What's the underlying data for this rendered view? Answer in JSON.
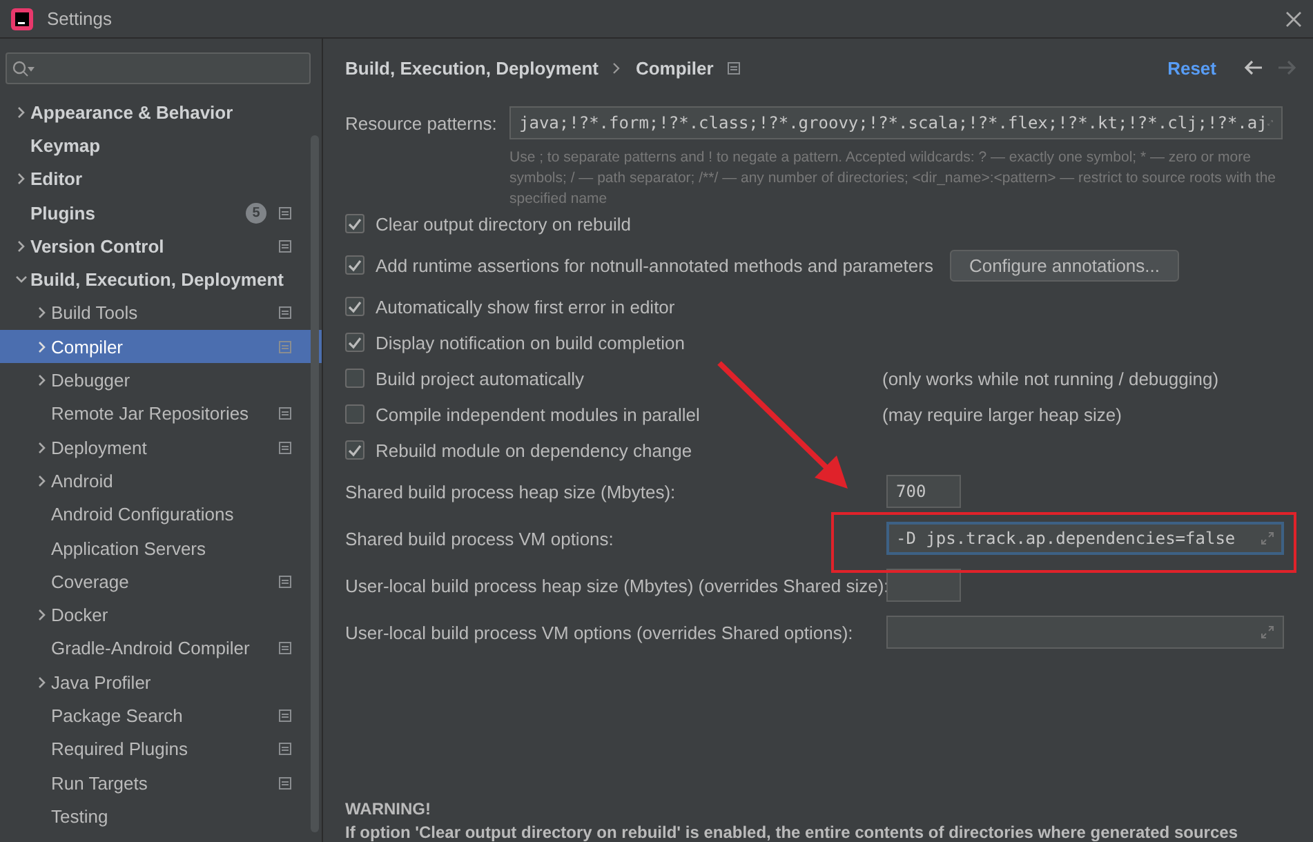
{
  "window": {
    "title": "Settings"
  },
  "sidebar": {
    "items": [
      {
        "label": "Appearance & Behavior",
        "kind": "group",
        "expanded": false,
        "selected": false,
        "project_level": false
      },
      {
        "label": "Keymap",
        "kind": "leaf",
        "selected": false,
        "project_level": false
      },
      {
        "label": "Editor",
        "kind": "group",
        "expanded": false,
        "selected": false,
        "project_level": false
      },
      {
        "label": "Plugins",
        "kind": "leaf",
        "selected": false,
        "project_level": true,
        "badge": "5"
      },
      {
        "label": "Version Control",
        "kind": "group",
        "expanded": false,
        "selected": false,
        "project_level": true
      },
      {
        "label": "Build, Execution, Deployment",
        "kind": "group",
        "expanded": true,
        "selected": false,
        "project_level": false,
        "children": [
          {
            "label": "Build Tools",
            "kind": "group",
            "expanded": false,
            "selected": false,
            "project_level": true
          },
          {
            "label": "Compiler",
            "kind": "group",
            "expanded": false,
            "selected": true,
            "project_level": true
          },
          {
            "label": "Debugger",
            "kind": "group",
            "expanded": false,
            "selected": false,
            "project_level": false
          },
          {
            "label": "Remote Jar Repositories",
            "kind": "leaf",
            "selected": false,
            "project_level": true
          },
          {
            "label": "Deployment",
            "kind": "group",
            "expanded": false,
            "selected": false,
            "project_level": true
          },
          {
            "label": "Android",
            "kind": "group",
            "expanded": false,
            "selected": false,
            "project_level": false
          },
          {
            "label": "Android Configurations",
            "kind": "leaf",
            "selected": false,
            "project_level": false
          },
          {
            "label": "Application Servers",
            "kind": "leaf",
            "selected": false,
            "project_level": false
          },
          {
            "label": "Coverage",
            "kind": "leaf",
            "selected": false,
            "project_level": true
          },
          {
            "label": "Docker",
            "kind": "group",
            "expanded": false,
            "selected": false,
            "project_level": false
          },
          {
            "label": "Gradle-Android Compiler",
            "kind": "leaf",
            "selected": false,
            "project_level": true
          },
          {
            "label": "Java Profiler",
            "kind": "group",
            "expanded": false,
            "selected": false,
            "project_level": false
          },
          {
            "label": "Package Search",
            "kind": "leaf",
            "selected": false,
            "project_level": true
          },
          {
            "label": "Required Plugins",
            "kind": "leaf",
            "selected": false,
            "project_level": true
          },
          {
            "label": "Run Targets",
            "kind": "leaf",
            "selected": false,
            "project_level": true
          },
          {
            "label": "Testing",
            "kind": "leaf",
            "selected": false,
            "project_level": false
          }
        ]
      }
    ]
  },
  "header": {
    "breadcrumbs": [
      "Build, Execution, Deployment",
      "Compiler"
    ],
    "project_level": true,
    "reset": "Reset",
    "back_disabled": false,
    "forward_disabled": true
  },
  "resource_patterns": {
    "label": "Resource patterns:",
    "value": "java;!?*.form;!?*.class;!?*.groovy;!?*.scala;!?*.flex;!?*.kt;!?*.clj;!?*.aj",
    "help": "Use ; to separate patterns and ! to negate a pattern. Accepted wildcards: ? — exactly one symbol; * — zero or more symbols; / — path separator; /**/ — any number of directories; <dir_name>:<pattern> — restrict to source roots with the specified name"
  },
  "options": [
    {
      "kind": "checkbox",
      "label": "Clear output directory on rebuild",
      "checked": true
    },
    {
      "kind": "checkbox",
      "label": "Add runtime assertions for notnull-annotated methods and parameters",
      "checked": true,
      "button": "Configure annotations..."
    },
    {
      "kind": "checkbox",
      "label": "Automatically show first error in editor",
      "checked": true
    },
    {
      "kind": "checkbox",
      "label": "Display notification on build completion",
      "checked": true
    },
    {
      "kind": "checkbox",
      "label": "Build project automatically",
      "checked": false,
      "note": "(only works while not running / debugging)"
    },
    {
      "kind": "checkbox",
      "label": "Compile independent modules in parallel",
      "checked": false,
      "note": "(may require larger heap size)"
    },
    {
      "kind": "checkbox",
      "label": "Rebuild module on dependency change",
      "checked": true
    },
    {
      "kind": "short_field",
      "label": "Shared build process heap size (Mbytes):",
      "value": "700",
      "focused": false
    },
    {
      "kind": "wide_field",
      "label": "Shared build process VM options:",
      "value": "-D jps.track.ap.dependencies=false",
      "focused": true
    },
    {
      "kind": "short_field",
      "label": "User-local build process heap size (Mbytes) (overrides Shared size):",
      "focused": false
    },
    {
      "kind": "wide_field",
      "label": "User-local build process VM options (overrides Shared options):",
      "focused": false
    }
  ],
  "warning": {
    "title": "WARNING!",
    "text": "If option 'Clear output directory on rebuild' is enabled, the entire contents of directories where generated sources"
  }
}
